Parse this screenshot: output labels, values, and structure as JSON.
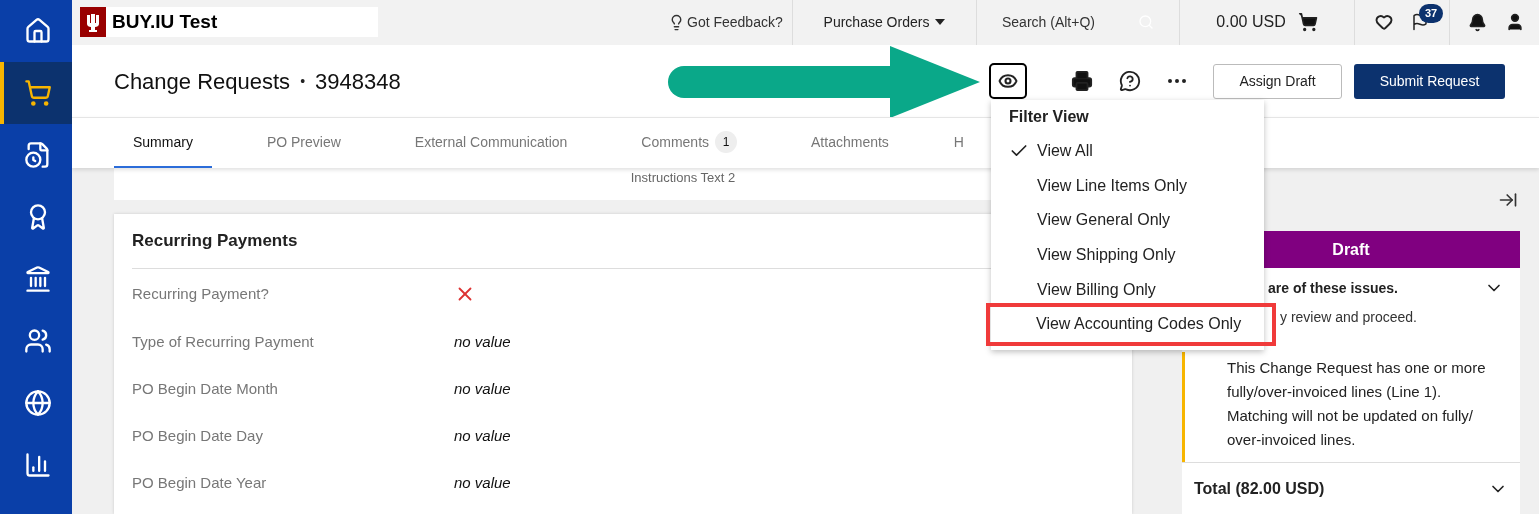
{
  "sidebar": {
    "items": [
      {
        "selected": false
      },
      {
        "selected": true
      },
      {
        "selected": false
      },
      {
        "selected": false
      },
      {
        "selected": false
      },
      {
        "selected": false
      },
      {
        "selected": false
      },
      {
        "selected": false
      }
    ]
  },
  "topbar": {
    "logo_text": "BUY.IU Test",
    "feedback": "Got Feedback?",
    "menu": "Purchase Orders",
    "search_placeholder": "Search (Alt+Q)",
    "cart_total": "0.00 USD",
    "flag_badge": "37"
  },
  "header": {
    "title": "Change Requests",
    "separator": "•",
    "number": "3948348",
    "buttons": [
      "Assign Draft",
      "Submit Request"
    ]
  },
  "tabs": [
    {
      "label": "Summary",
      "selected": true
    },
    {
      "label": "PO Preview",
      "selected": false
    },
    {
      "label": "External Communication",
      "selected": false
    },
    {
      "label": "Comments",
      "selected": false,
      "badge": "1"
    },
    {
      "label": "Attachments",
      "selected": false
    },
    {
      "label": "H",
      "selected": false
    }
  ],
  "instructions": "Instructions Text 2",
  "recurring_payments": {
    "title": "Recurring Payments",
    "fields": [
      {
        "label": "Recurring Payment?",
        "kind": "cross"
      },
      {
        "label": "Type of Recurring Payment",
        "kind": "text",
        "value": "no value"
      },
      {
        "label": "PO Begin Date Month",
        "kind": "text",
        "value": "no value"
      },
      {
        "label": "PO Begin Date Day",
        "kind": "text",
        "value": "no value"
      },
      {
        "label": "PO Begin Date Year",
        "kind": "text",
        "value": "no value"
      }
    ]
  },
  "status_panel": {
    "status": "Draft",
    "issues_heading": "are of these issues.",
    "issues_sub": "y review and proceed.",
    "issue": "This Change Request has one or more fully/over-invoiced lines (Line 1). Matching will not be updated on fully/ over-invoiced lines.",
    "total": "Total (82.00 USD)"
  },
  "filter_menu": {
    "title": "Filter View",
    "items": [
      {
        "label": "View All",
        "selected": true,
        "highlighted": false
      },
      {
        "label": "View Line Items Only",
        "selected": false,
        "highlighted": false
      },
      {
        "label": "View General Only",
        "selected": false,
        "highlighted": false
      },
      {
        "label": "View Shipping Only",
        "selected": false,
        "highlighted": false
      },
      {
        "label": "View Billing Only",
        "selected": false,
        "highlighted": false
      },
      {
        "label": "View Accounting Codes Only",
        "selected": false,
        "highlighted": true
      }
    ]
  }
}
